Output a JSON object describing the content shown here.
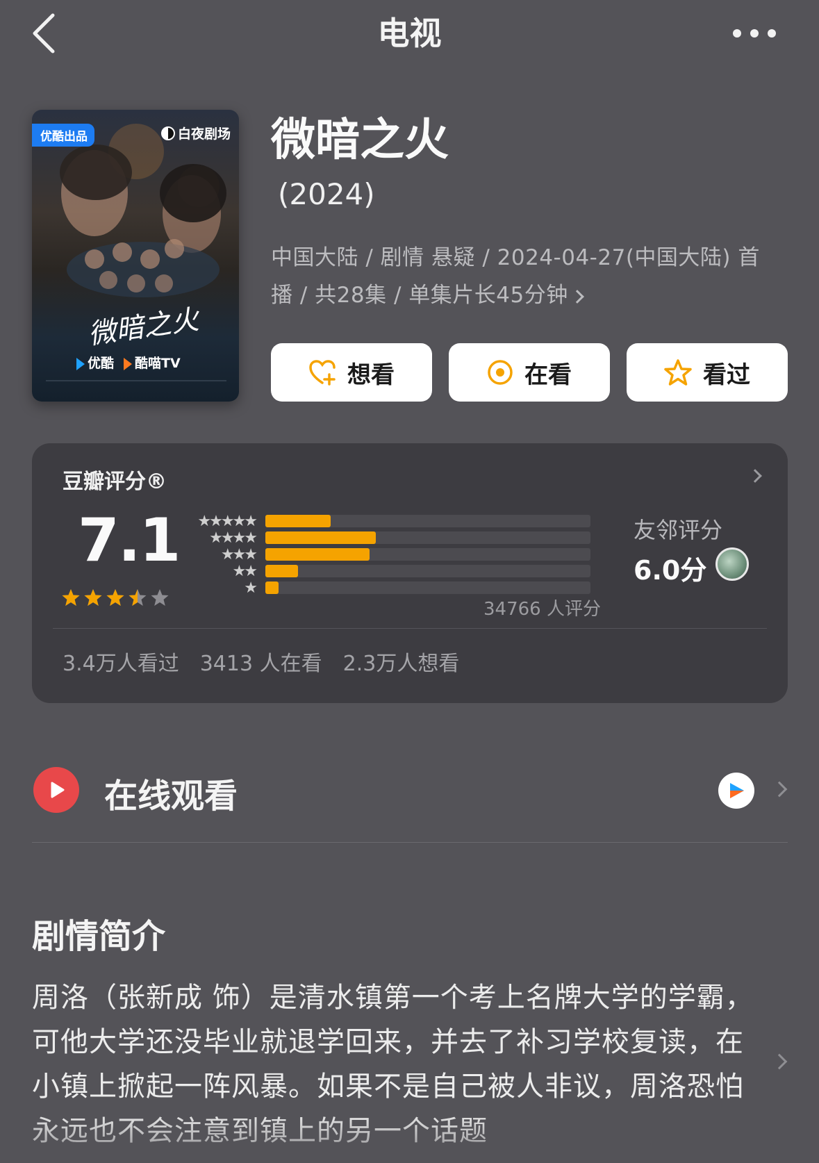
{
  "header": {
    "title": "电视",
    "back_icon": "chevron-left-icon",
    "more_icon": "more-horizontal-icon"
  },
  "poster": {
    "tag": "优酷出品",
    "brand": "白夜剧场",
    "title_art": "微暗之火",
    "platforms": [
      "优酷",
      "酷喵TV"
    ]
  },
  "show": {
    "title": "微暗之火",
    "year": "(2024)",
    "meta": "中国大陆 / 剧情 悬疑 / 2024-04-27(中国大陆) 首播 / 共28集 / 单集片长45分钟"
  },
  "actions": [
    {
      "label": "想看",
      "icon": "heart-plus-icon"
    },
    {
      "label": "在看",
      "icon": "target-icon"
    },
    {
      "label": "看过",
      "icon": "star-outline-icon"
    }
  ],
  "rating": {
    "label": "豆瓣评分®",
    "score": "7.1",
    "stars": 3.5,
    "distribution": [
      {
        "stars": 5,
        "fraction": 0.2
      },
      {
        "stars": 4,
        "fraction": 0.34
      },
      {
        "stars": 3,
        "fraction": 0.32
      },
      {
        "stars": 2,
        "fraction": 0.1
      },
      {
        "stars": 1,
        "fraction": 0.04
      }
    ],
    "count_text": "34766 人评分",
    "friend_label": "友邻评分",
    "friend_score": "6.0分",
    "stats": [
      "3.4万人看过",
      "3413 人在看",
      "2.3万人想看"
    ]
  },
  "online": {
    "label": "在线观看",
    "icon": "play-icon",
    "platform_icon": "youku-icon"
  },
  "synopsis": {
    "title": "剧情简介",
    "text": "周洛（张新成 饰）是清水镇第一个考上名牌大学的学霸，可他大学还没毕业就退学回来，并去了补习学校复读，在小镇上掀起一阵风暴。如果不是自己被人非议，周洛恐怕永远也不会注意到镇上的另一个话题"
  },
  "colors": {
    "background": "#545358",
    "card": "#3d3c41",
    "accent": "#f5a300",
    "play_red": "#e8484a"
  }
}
